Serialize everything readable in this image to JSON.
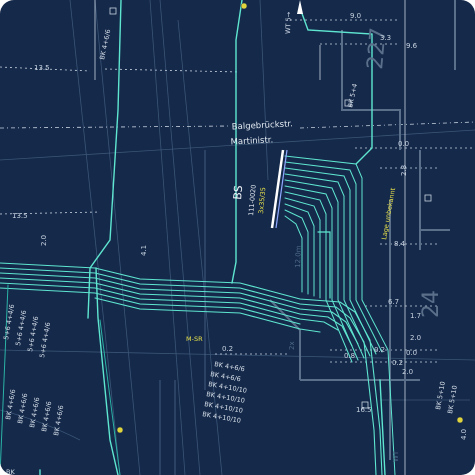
{
  "colors": {
    "background": "#15294a",
    "cable": "#5ee6d0",
    "cable_dark": "#2bb3a6",
    "highlight": "#8fa8ff",
    "dimension_line": "#c9d4e2",
    "yellow_label": "#e8e24a",
    "grey_outline": "#5a6f8a"
  },
  "streets": {
    "upper": "Balgebrückstr.",
    "lower": "Martinistr."
  },
  "distribution": {
    "code": "BS",
    "id": "111-0020",
    "cable": "3x35/35"
  },
  "annotations": {
    "cable_length": "12.0m",
    "location_unknown": "Lage unbekannt",
    "msr": "M-SR",
    "wt": "WT 5→",
    "plot_227": "227",
    "plot_24": "24",
    "plot_2x": "2x",
    "wt_small": "WT"
  },
  "dimensions": [
    "13.5",
    "13.5",
    "9.0",
    "3.3",
    "9.6",
    "0.0",
    "2.8",
    "8.4",
    "6.7",
    "1.7",
    "2.0",
    "0.0",
    "0.2",
    "0.2",
    "0.8",
    "2.0",
    "0.2",
    "16.5",
    "2.0",
    "4.1",
    "4.0"
  ],
  "cable_labels": {
    "top_left": "BK 4+6/6",
    "top_right": "BK 5+4",
    "stack_bottom": [
      "BK 4+6/6",
      "BK 4+6/6",
      "BK 4+10/10",
      "BK 4+10/10",
      "BK 4+10/10",
      "BK 4+10/10"
    ],
    "left_column_a": [
      "5+6 4+4/6",
      "5+6 4+4/6",
      "5+6 4+4/6",
      "5+6 4+4/6"
    ],
    "left_column_b": [
      "BK 4+6/6",
      "BK 4+6/6",
      "BK 4+6/6",
      "BK 4+6/6",
      "BK 4+6/6"
    ],
    "right_bottom": [
      "BK 5+10",
      "BK 5+10"
    ],
    "bottom_left": "BK"
  }
}
